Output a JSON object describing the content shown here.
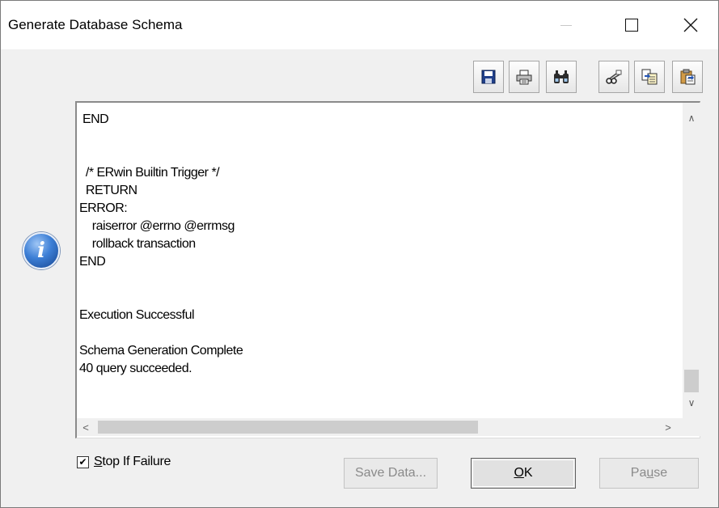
{
  "window": {
    "title": "Generate Database Schema"
  },
  "titlebar": {
    "close_glyph": "✕"
  },
  "toolbar": {
    "buttons": [
      {
        "name": "save-icon"
      },
      {
        "name": "print-icon"
      },
      {
        "name": "find-icon"
      },
      {
        "name": "cut-icon"
      },
      {
        "name": "copy-icon"
      },
      {
        "name": "paste-icon"
      }
    ]
  },
  "log": {
    "lines": [
      " END",
      "",
      "",
      "  /* ERwin Builtin Trigger */",
      "  RETURN",
      "ERROR:",
      "    raiserror @errno @errmsg",
      "    rollback transaction",
      "END",
      "",
      "",
      "Execution Successful",
      "",
      "Schema Generation Complete",
      "40 query succeeded."
    ]
  },
  "scroll": {
    "up_glyph": "∧",
    "down_glyph": "∨",
    "left_glyph": "<",
    "right_glyph": ">"
  },
  "options": {
    "stop_if_failure": {
      "checked": true,
      "mark": "✔",
      "label_mnemonic": "S",
      "label_rest": "top If Failure"
    }
  },
  "buttons": {
    "save_data": "Save Data...",
    "ok_mnemonic": "O",
    "ok_rest": "K",
    "pause_pre": "Pa",
    "pause_mnemonic": "u",
    "pause_post": "se"
  },
  "info_icon": {
    "glyph": "i"
  }
}
